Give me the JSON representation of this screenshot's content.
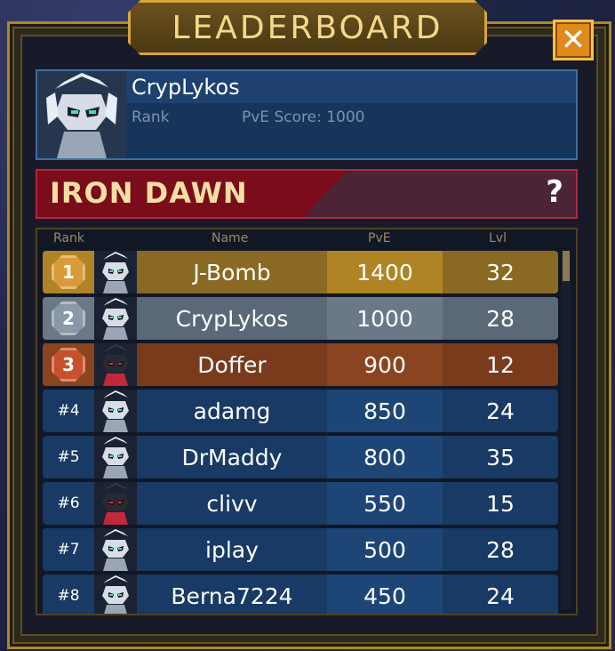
{
  "title": "LEADERBOARD",
  "close_glyph": "✕",
  "player": {
    "name": "CrypLykos",
    "rank_label": "Rank",
    "score_label": "PvE Score: 1000",
    "avatar_icon": "robot-avatar-icon"
  },
  "guild": {
    "name": "IRON DAWN",
    "help_glyph": "?"
  },
  "columns": {
    "rank": "Rank",
    "name": "Name",
    "pve": "PvE",
    "lvl": "Lvl"
  },
  "rows": [
    {
      "rank": "1",
      "name": "J-Bomb",
      "pve": "1400",
      "lvl": "32",
      "style": "gold",
      "medal_color": "#d89a3a",
      "avatar": "white-robot"
    },
    {
      "rank": "2",
      "name": "CrypLykos",
      "pve": "1000",
      "lvl": "28",
      "style": "silver",
      "medal_color": "#8a98a8",
      "avatar": "white-robot"
    },
    {
      "rank": "3",
      "name": "Doffer",
      "pve": "900",
      "lvl": "12",
      "style": "bronze",
      "medal_color": "#c8502a",
      "avatar": "dark-robot"
    },
    {
      "rank": "#4",
      "name": "adamg",
      "pve": "850",
      "lvl": "24",
      "style": "blue",
      "avatar": "white-robot"
    },
    {
      "rank": "#5",
      "name": "DrMaddy",
      "pve": "800",
      "lvl": "35",
      "style": "blue",
      "avatar": "white-robot"
    },
    {
      "rank": "#6",
      "name": "clivv",
      "pve": "550",
      "lvl": "15",
      "style": "blue",
      "avatar": "dark-robot"
    },
    {
      "rank": "#7",
      "name": "iplay",
      "pve": "500",
      "lvl": "28",
      "style": "blue",
      "avatar": "white-robot"
    },
    {
      "rank": "#8",
      "name": "Berna7224",
      "pve": "450",
      "lvl": "24",
      "style": "blue",
      "avatar": "white-robot"
    }
  ],
  "colors": {
    "gold_row": "#8a6a22",
    "gold_pve": "#b08424",
    "silver_row": "#5a6878",
    "silver_pve": "#6a7888",
    "bronze_row": "#7a3a1c",
    "bronze_pve": "#8a4420",
    "blue_row": "#183a64",
    "blue_pve": "#1d4576"
  }
}
